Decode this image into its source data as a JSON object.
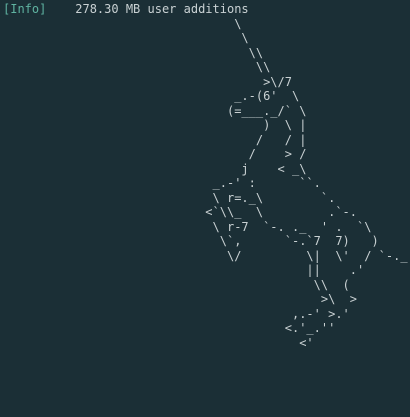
{
  "status": {
    "tag": "[Info]",
    "message": "    278.30 MB user additions"
  },
  "art_lines": [
    "                                \\",
    "                                 \\",
    "                                  \\\\",
    "                                   \\\\",
    "                                    >\\/7",
    "                                _.-(6'  \\",
    "                               (=___._/` \\",
    "                                    )  \\ |",
    "                                   /   / |",
    "                                  /    > /",
    "                                 j    < _\\",
    "                             _.-' :      ``.",
    "                             \\ r=._\\        `.",
    "                            <`\\\\_  \\         .`-.",
    "                             \\ r-7  `-. ._  ' .  `\\",
    "                              \\`,      `-.`7  7)   )",
    "                               \\/         \\|  \\'  / `-._",
    "                                          ||    .'",
    "                                           \\\\  (",
    "                                            >\\  >",
    "                                        ,.-' >.'",
    "                                       <.'_.''",
    "                                         <'"
  ]
}
